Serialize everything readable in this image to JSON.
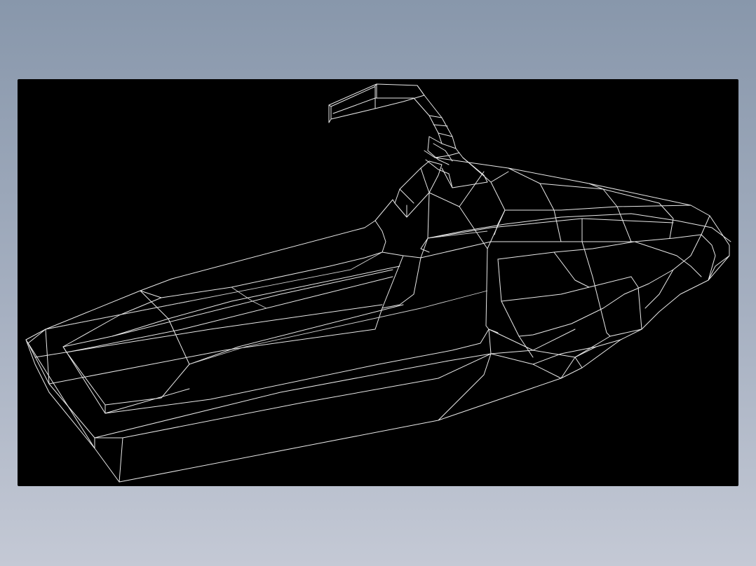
{
  "scene": {
    "subject": "jet-ski-wireframe",
    "background_color": "#000000",
    "line_color": "#e9e9e9",
    "page_gradient": [
      "#8897ab",
      "#c4c9d5"
    ]
  }
}
